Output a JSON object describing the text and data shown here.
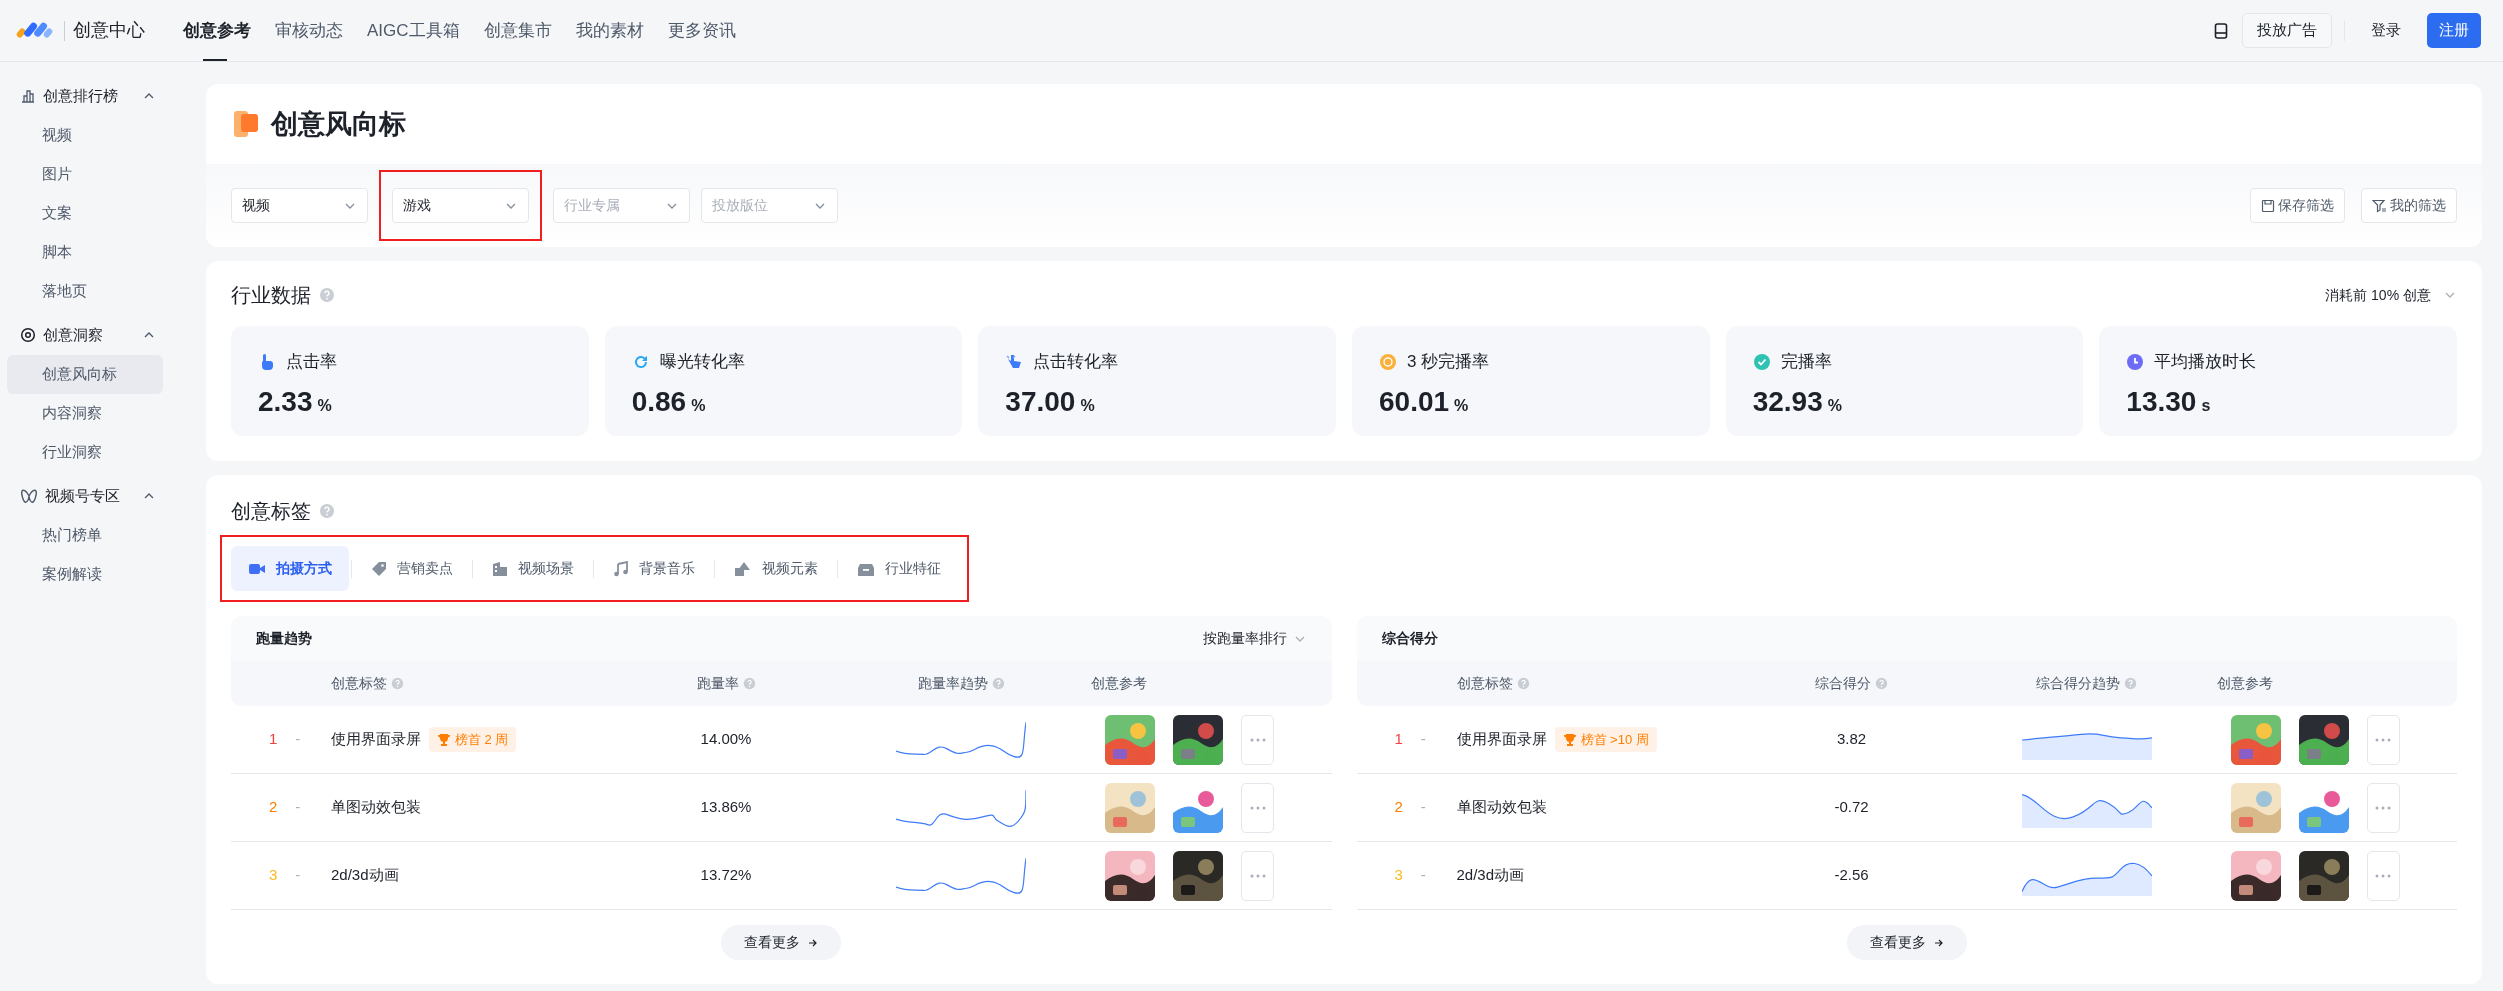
{
  "brand": {
    "name": "创意中心"
  },
  "nav": [
    {
      "label": "创意参考",
      "selected": true
    },
    {
      "label": "审核动态",
      "selected": false
    },
    {
      "label": "AIGC工具箱",
      "selected": false
    },
    {
      "label": "创意集市",
      "selected": false
    },
    {
      "label": "我的素材",
      "selected": false
    },
    {
      "label": "更多资讯",
      "selected": false
    }
  ],
  "header_actions": {
    "advertise": "投放广告",
    "login": "登录",
    "register": "注册"
  },
  "sidebar": [
    {
      "label": "创意排行榜",
      "expanded": true,
      "children": [
        {
          "label": "视频",
          "selected": false
        },
        {
          "label": "图片",
          "selected": false
        },
        {
          "label": "文案",
          "selected": false
        },
        {
          "label": "脚本",
          "selected": false
        },
        {
          "label": "落地页",
          "selected": false
        }
      ]
    },
    {
      "label": "创意洞察",
      "expanded": true,
      "children": [
        {
          "label": "创意风向标",
          "selected": true
        },
        {
          "label": "内容洞察",
          "selected": false
        },
        {
          "label": "行业洞察",
          "selected": false
        }
      ]
    },
    {
      "label": "视频号专区",
      "expanded": true,
      "children": [
        {
          "label": "热门榜单",
          "selected": false
        },
        {
          "label": "案例解读",
          "selected": false
        }
      ]
    }
  ],
  "page_title": "创意风向标",
  "filters": [
    {
      "value": "视频",
      "highlighted": false
    },
    {
      "value": "游戏",
      "highlighted": true
    },
    {
      "placeholder": "行业专属",
      "highlighted": false
    },
    {
      "placeholder": "投放版位",
      "highlighted": false
    }
  ],
  "filter_actions": [
    "保存筛选",
    "我的筛选"
  ],
  "industry": {
    "title": "行业数据",
    "scope": "消耗前 10% 创意",
    "metrics": [
      {
        "label": "点击率",
        "value": "2.33",
        "unit": "%"
      },
      {
        "label": "曝光转化率",
        "value": "0.86",
        "unit": "%"
      },
      {
        "label": "点击转化率",
        "value": "37.00",
        "unit": "%"
      },
      {
        "label": "3 秒完播率",
        "value": "60.01",
        "unit": "%"
      },
      {
        "label": "完播率",
        "value": "32.93",
        "unit": "%"
      },
      {
        "label": "平均播放时长",
        "value": "13.30",
        "unit": "s"
      }
    ]
  },
  "tags": {
    "title": "创意标签",
    "highlighted": true,
    "tabs": [
      {
        "label": "拍摄方式",
        "selected": true
      },
      {
        "label": "营销卖点",
        "selected": false
      },
      {
        "label": "视频场景",
        "selected": false
      },
      {
        "label": "背景音乐",
        "selected": false
      },
      {
        "label": "视频元素",
        "selected": false
      },
      {
        "label": "行业特征",
        "selected": false
      }
    ],
    "tables": [
      {
        "title": "跑量趋势",
        "sort": "按跑量率排行",
        "columns": [
          "创意标签",
          "跑量率",
          "跑量率趋势",
          "创意参考"
        ],
        "rows": [
          {
            "rank": "1",
            "color": "#f53f3f",
            "change": "-",
            "label": "使用界面录屏",
            "badge": "榜首 2 周",
            "value": "14.00%"
          },
          {
            "rank": "2",
            "color": "#ff7d00",
            "change": "-",
            "label": "单图动效包装",
            "value": "13.86%"
          },
          {
            "rank": "3",
            "color": "#f7ba1e",
            "change": "-",
            "label": "2d/3d动画",
            "value": "13.72%"
          }
        ],
        "more": "查看更多"
      },
      {
        "title": "综合得分",
        "columns": [
          "创意标签",
          "综合得分",
          "综合得分趋势",
          "创意参考"
        ],
        "rows": [
          {
            "rank": "1",
            "color": "#f53f3f",
            "change": "-",
            "label": "使用界面录屏",
            "badge": "榜首 >10 周",
            "value": "3.82"
          },
          {
            "rank": "2",
            "color": "#ff7d00",
            "change": "-",
            "label": "单图动效包装",
            "value": "-0.72"
          },
          {
            "rank": "3",
            "color": "#f7ba1e",
            "change": "-",
            "label": "2d/3d动画",
            "value": "-2.56"
          }
        ],
        "more": "查看更多"
      }
    ]
  }
}
